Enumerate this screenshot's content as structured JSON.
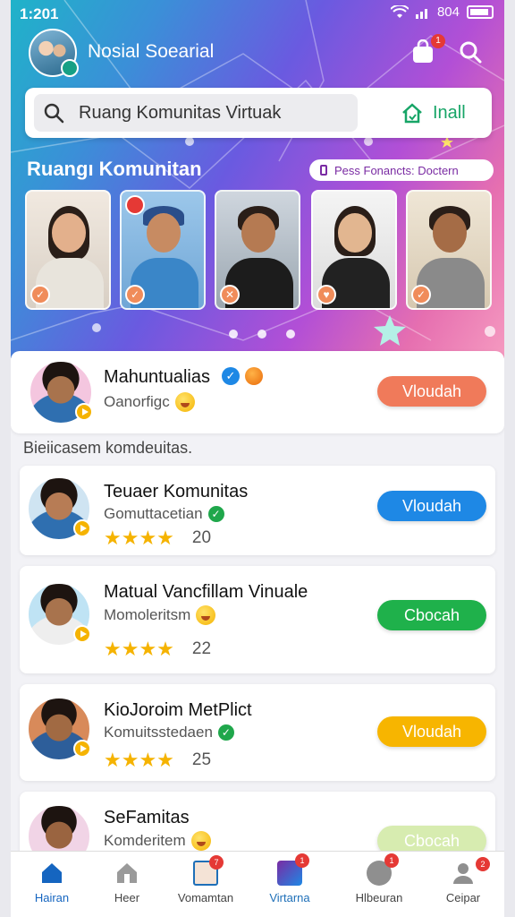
{
  "status": {
    "time": "1:201",
    "carrier": "804"
  },
  "header": {
    "title": "Nosial Soearial",
    "cart_badge": "1"
  },
  "search": {
    "placeholder": "Ruang Komunitas Virtuak",
    "install_label": "Inall"
  },
  "section": {
    "title": "Ruangı Komunitan",
    "pill": "Pess Fonancts:  Doctern"
  },
  "featured": {
    "name": "Mahuntualias",
    "sub": "Oanorfigc",
    "button": "Vloudah",
    "button_color": "#f07a5a"
  },
  "caption": "Bieiicasem komdeuitas.",
  "list": [
    {
      "name": "Teuaer Komunitas",
      "sub": "Gomuttacetian",
      "rating": 4,
      "count": "20",
      "button": "Vloudah",
      "button_color": "#1e88e5"
    },
    {
      "name": "Matual Vancfillam Vinuale",
      "sub": "Momoleritsm",
      "rating": 4,
      "count": "22",
      "button": "Cbocah",
      "button_color": "#1fb14b"
    },
    {
      "name": "KioJoroim MetPlict",
      "sub": "Komuitsstedaen",
      "rating": 4,
      "count": "25",
      "button": "Vloudah",
      "button_color": "#f7b500"
    },
    {
      "name": "SeFamitas",
      "sub": "Komderitem",
      "button": "Cbocah",
      "button_color": "#d7ecb0"
    }
  ],
  "nav": [
    {
      "label": "Hairan",
      "icon": "home-icon"
    },
    {
      "label": "Heer",
      "icon": "house-outline-icon"
    },
    {
      "label": "Vomamtan",
      "icon": "edit-icon",
      "badge": "7"
    },
    {
      "label": "Virtarna",
      "icon": "gallery-icon",
      "badge": "1"
    },
    {
      "label": "Hlbeuran",
      "icon": "check-circle-icon",
      "badge": "1"
    },
    {
      "label": "Ceipar",
      "icon": "profile-icon",
      "badge": "2"
    }
  ],
  "colors": {
    "primary": "#1e88e5",
    "accent": "#7a2ba3"
  }
}
